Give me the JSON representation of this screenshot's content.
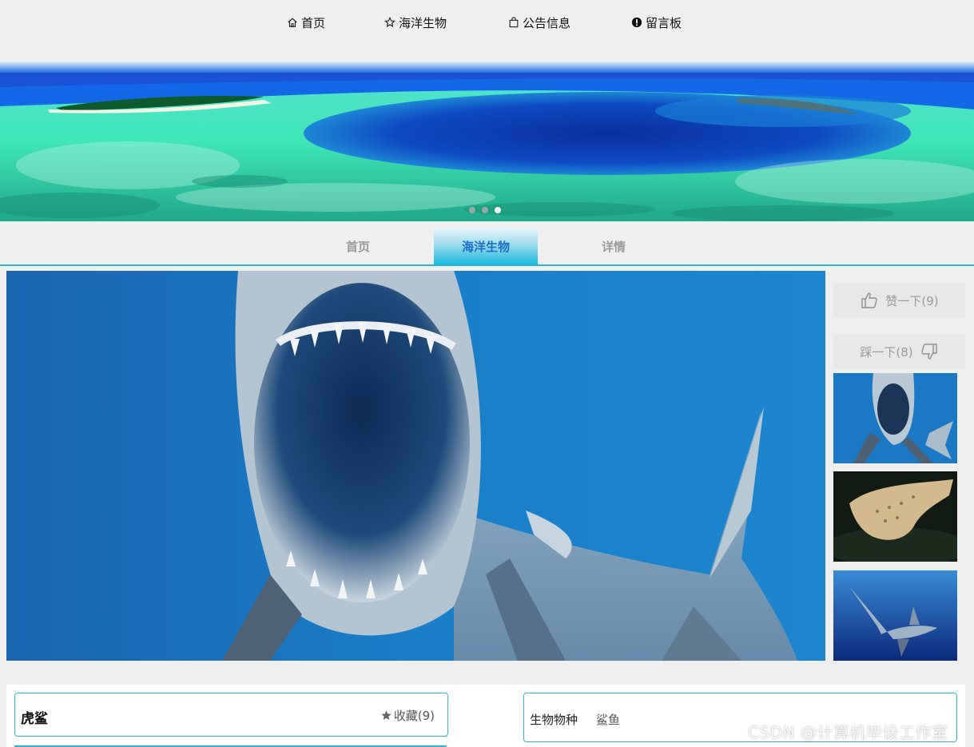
{
  "topnav": {
    "items": [
      {
        "label": "首页",
        "icon": "home-icon"
      },
      {
        "label": "海洋生物",
        "icon": "star-icon"
      },
      {
        "label": "公告信息",
        "icon": "shopping-bag-icon"
      },
      {
        "label": "留言板",
        "icon": "exclamation-circle-icon"
      }
    ]
  },
  "banner": {
    "active_dot": 2,
    "dot_count": 3
  },
  "subnav": {
    "tabs": [
      {
        "label": "首页",
        "active": false
      },
      {
        "label": "海洋生物",
        "active": true
      },
      {
        "label": "详情",
        "active": false
      }
    ]
  },
  "votes": {
    "like_label": "赞一下(9)",
    "dislike_label": "踩一下(8)"
  },
  "detail": {
    "name": "虎鲨",
    "favorite_label": "收藏(9)",
    "species_label": "生物物种",
    "species_value": "鲨鱼"
  },
  "watermark": "CSDN @计算机毕设工作室",
  "colors": {
    "accent": "#2cb6d6",
    "active_tab_text": "#1b6fc6",
    "background": "#efefef"
  }
}
